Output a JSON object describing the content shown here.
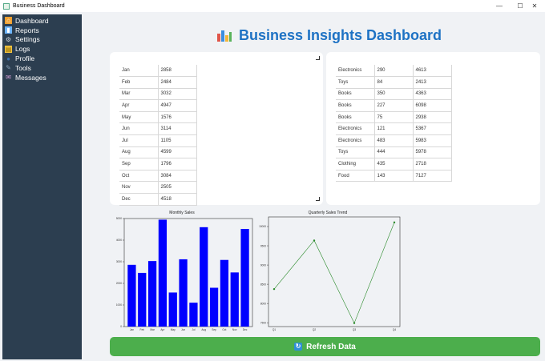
{
  "window": {
    "title": "Business Dashboard",
    "minimize": "—",
    "maximize": "☐",
    "close": "✕"
  },
  "sidebar": {
    "items": [
      {
        "label": "Dashboard",
        "icon": "dashboard-icon",
        "glyph": "⌂",
        "color": "#f0a030"
      },
      {
        "label": "Reports",
        "icon": "reports-icon",
        "glyph": "▮",
        "color": "#6fb6ff"
      },
      {
        "label": "Settings",
        "icon": "gear-icon",
        "glyph": "⚙",
        "color": "#cfd6dd"
      },
      {
        "label": "Logs",
        "icon": "logs-icon",
        "glyph": "▤",
        "color": "#f5c542"
      },
      {
        "label": "Profile",
        "icon": "profile-icon",
        "glyph": "●",
        "color": "#3a6fb0"
      },
      {
        "label": "Tools",
        "icon": "tools-icon",
        "glyph": "✎",
        "color": "#8aa0b8"
      },
      {
        "label": "Messages",
        "icon": "mail-icon",
        "glyph": "✉",
        "color": "#d9a0d9"
      }
    ]
  },
  "header": {
    "title": "Business Insights Dashboard",
    "icon": "bar-chart-icon"
  },
  "monthly_table": {
    "rows": [
      [
        "Jan",
        "2858"
      ],
      [
        "Feb",
        "2484"
      ],
      [
        "Mar",
        "3032"
      ],
      [
        "Apr",
        "4947"
      ],
      [
        "May",
        "1576"
      ],
      [
        "Jun",
        "3114"
      ],
      [
        "Jul",
        "1105"
      ],
      [
        "Aug",
        "4599"
      ],
      [
        "Sep",
        "1796"
      ],
      [
        "Oct",
        "3084"
      ],
      [
        "Nov",
        "2505"
      ],
      [
        "Dec",
        "4518"
      ]
    ]
  },
  "product_table": {
    "rows": [
      [
        "Electronics",
        "290",
        "4613"
      ],
      [
        "Toys",
        "84",
        "2413"
      ],
      [
        "Books",
        "350",
        "4363"
      ],
      [
        "Books",
        "227",
        "6098"
      ],
      [
        "Books",
        "75",
        "2938"
      ],
      [
        "Electronics",
        "121",
        "5367"
      ],
      [
        "Electronics",
        "483",
        "5983"
      ],
      [
        "Toys",
        "444",
        "5978"
      ],
      [
        "Clothing",
        "435",
        "2718"
      ],
      [
        "Food",
        "143",
        "7127"
      ]
    ]
  },
  "chart_data": [
    {
      "type": "bar",
      "title": "Monthly Sales",
      "categories": [
        "Jan",
        "Feb",
        "Mar",
        "Apr",
        "May",
        "Jun",
        "Jul",
        "Aug",
        "Sep",
        "Oct",
        "Nov",
        "Dec"
      ],
      "values": [
        2858,
        2484,
        3032,
        4947,
        1576,
        3114,
        1105,
        4599,
        1796,
        3084,
        2505,
        4518
      ],
      "ylim": [
        0,
        5000
      ],
      "yticks": [
        "0",
        "1000",
        "2000",
        "3000",
        "4000",
        "5000"
      ],
      "color": "#0000ff"
    },
    {
      "type": "line",
      "title": "Quarterly Sales Trend",
      "categories": [
        "Q1",
        "Q2",
        "Q3",
        "Q4"
      ],
      "values": [
        8374,
        9637,
        7490,
        10107
      ],
      "ylim": [
        7400,
        10250
      ],
      "yticks": [
        "7500",
        "8000",
        "8500",
        "9000",
        "9500",
        "10000"
      ],
      "color": "#2a8a2a"
    }
  ],
  "actions": {
    "refresh_label": "Refresh Data",
    "refresh_icon": "refresh-icon",
    "refresh_glyph": "↻"
  }
}
